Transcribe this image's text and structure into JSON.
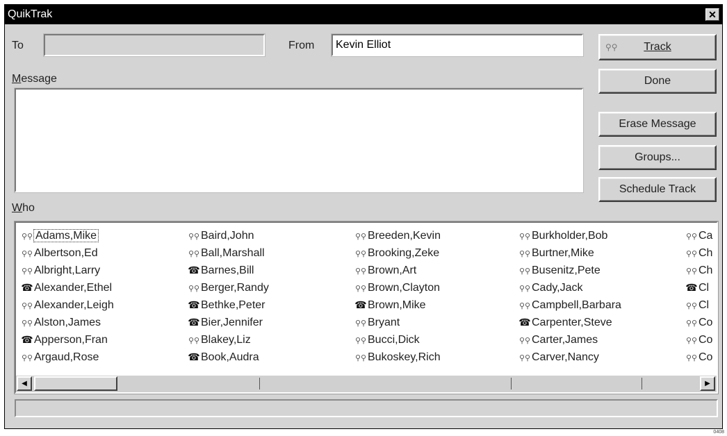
{
  "window": {
    "title": "QuikTrak",
    "close_label": "✕"
  },
  "to": {
    "label": "To",
    "value": ""
  },
  "from": {
    "label": "From",
    "value": "Kevin Elliot"
  },
  "message": {
    "label": "Message",
    "value": ""
  },
  "who": {
    "label": "Who"
  },
  "buttons": {
    "track": {
      "label": "Track",
      "icon": "person-icon"
    },
    "done": {
      "label": "Done"
    },
    "erase": {
      "label": "Erase Message"
    },
    "groups": {
      "label": "Groups..."
    },
    "schedule": {
      "label": "Schedule Track"
    }
  },
  "people": {
    "columns": [
      [
        {
          "name": "Adams,Mike",
          "icon": "person",
          "selected": true
        },
        {
          "name": "Albertson,Ed",
          "icon": "person"
        },
        {
          "name": "Albright,Larry",
          "icon": "person"
        },
        {
          "name": "Alexander,Ethel",
          "icon": "phone"
        },
        {
          "name": "Alexander,Leigh",
          "icon": "person"
        },
        {
          "name": "Alston,James",
          "icon": "person"
        },
        {
          "name": "Apperson,Fran",
          "icon": "phone"
        },
        {
          "name": "Argaud,Rose",
          "icon": "person"
        }
      ],
      [
        {
          "name": "Baird,John",
          "icon": "person"
        },
        {
          "name": "Ball,Marshall",
          "icon": "person"
        },
        {
          "name": "Barnes,Bill",
          "icon": "phone"
        },
        {
          "name": "Berger,Randy",
          "icon": "person"
        },
        {
          "name": "Bethke,Peter",
          "icon": "phone"
        },
        {
          "name": "Bier,Jennifer",
          "icon": "phone"
        },
        {
          "name": "Blakey,Liz",
          "icon": "person"
        },
        {
          "name": "Book,Audra",
          "icon": "phone"
        }
      ],
      [
        {
          "name": "Breeden,Kevin",
          "icon": "person"
        },
        {
          "name": "Brooking,Zeke",
          "icon": "person"
        },
        {
          "name": "Brown,Art",
          "icon": "person"
        },
        {
          "name": "Brown,Clayton",
          "icon": "person"
        },
        {
          "name": "Brown,Mike",
          "icon": "phone"
        },
        {
          "name": "Bryant",
          "icon": "person"
        },
        {
          "name": "Bucci,Dick",
          "icon": "person"
        },
        {
          "name": "Bukoskey,Rich",
          "icon": "person"
        }
      ],
      [
        {
          "name": "Burkholder,Bob",
          "icon": "person"
        },
        {
          "name": "Burtner,Mike",
          "icon": "person"
        },
        {
          "name": "Busenitz,Pete",
          "icon": "person"
        },
        {
          "name": "Cady,Jack",
          "icon": "person"
        },
        {
          "name": "Campbell,Barbara",
          "icon": "person"
        },
        {
          "name": "Carpenter,Steve",
          "icon": "phone"
        },
        {
          "name": "Carter,James",
          "icon": "person"
        },
        {
          "name": "Carver,Nancy",
          "icon": "person"
        }
      ],
      [
        {
          "name": "Ca",
          "icon": "person"
        },
        {
          "name": "Ch",
          "icon": "person"
        },
        {
          "name": "Ch",
          "icon": "person"
        },
        {
          "name": "Cl",
          "icon": "phone"
        },
        {
          "name": "Cl",
          "icon": "person"
        },
        {
          "name": "Co",
          "icon": "person"
        },
        {
          "name": "Co",
          "icon": "person"
        },
        {
          "name": "Co",
          "icon": "person"
        }
      ]
    ]
  },
  "scrollbar": {
    "left_arrow": "◀",
    "right_arrow": "▶"
  },
  "status": {
    "text": ""
  },
  "corner_code": "0408"
}
